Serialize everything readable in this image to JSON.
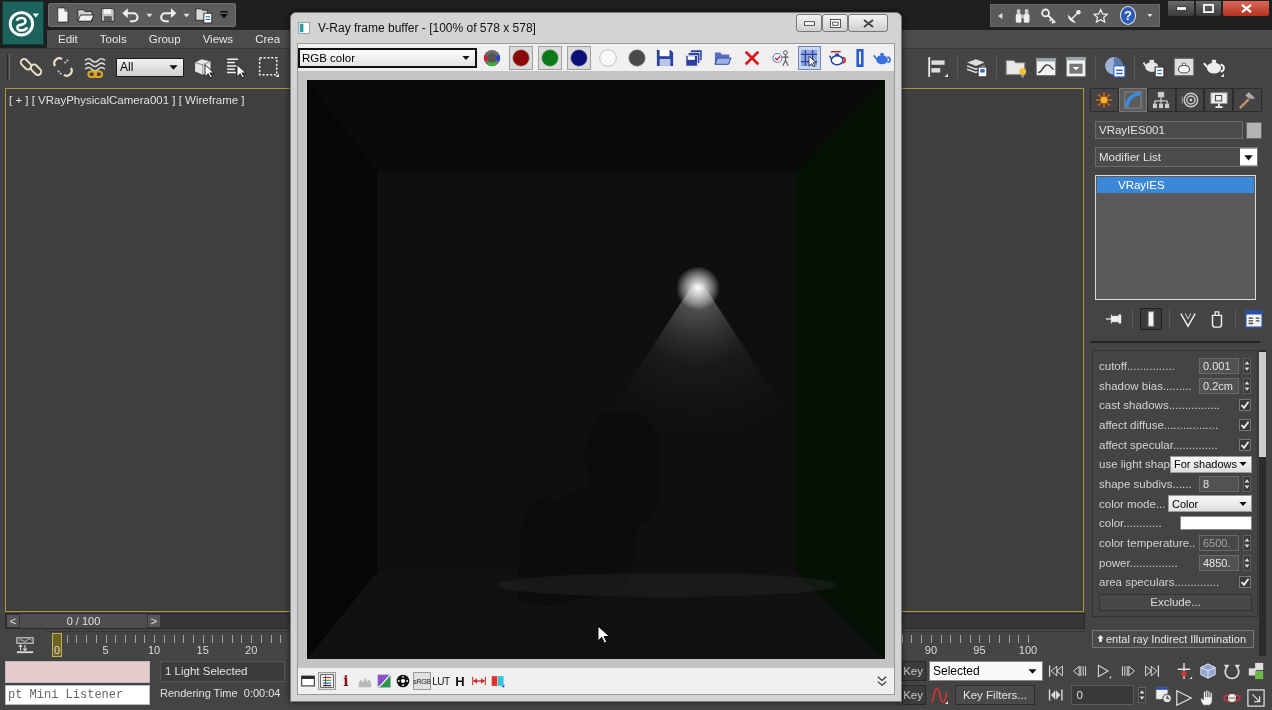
{
  "app": {
    "menu": [
      {
        "label": "Edit"
      },
      {
        "label": "Tools"
      },
      {
        "label": "Group"
      },
      {
        "label": "Views"
      },
      {
        "label": "Crea"
      }
    ],
    "help": "?",
    "selection_filter": "All"
  },
  "viewport": {
    "label": "[ + ] [ VRayPhysicalCamera001 ] [ Wireframe ]"
  },
  "command_panel": {
    "tabs": [
      {
        "kind": "create",
        "selected": false
      },
      {
        "kind": "modify",
        "selected": true
      },
      {
        "kind": "hierarchy",
        "selected": false
      },
      {
        "kind": "motion",
        "selected": false
      },
      {
        "kind": "display",
        "selected": false
      },
      {
        "kind": "utilities",
        "selected": false
      }
    ],
    "object_name": "VRayIES001",
    "modifier_list": "Modifier List",
    "stack": [
      {
        "label": "VRayIES",
        "selected": true
      }
    ],
    "stack_tools": [
      {
        "kind": "pin",
        "on": false
      },
      {
        "kind": "end-result",
        "on": true
      },
      {
        "kind": "unique",
        "on": false
      },
      {
        "kind": "remove",
        "on": false
      },
      {
        "kind": "configure",
        "on": false
      }
    ],
    "params": [
      {
        "kind": "spinner",
        "label": "cutoff...............",
        "value": "0.001",
        "disabled": false
      },
      {
        "kind": "spinner",
        "label": "shadow bias.........",
        "value": "0.2cm",
        "disabled": false
      },
      {
        "kind": "checkbox",
        "label": "cast shadows................",
        "checked": true
      },
      {
        "kind": "checkbox",
        "label": "affect diffuse.................",
        "checked": true
      },
      {
        "kind": "checkbox",
        "label": "affect specular..............",
        "checked": true
      },
      {
        "kind": "dropdown",
        "label": "use light shap",
        "value": "For shadows"
      },
      {
        "kind": "spinner",
        "label": "shape subdivs......",
        "value": "8",
        "disabled": false
      },
      {
        "kind": "dropdown",
        "label": "color mode...",
        "value": "Color"
      },
      {
        "kind": "color",
        "label": "color............",
        "color": "#ffffff"
      },
      {
        "kind": "spinner",
        "label": "color temperature..",
        "value": "6500.",
        "disabled": true
      },
      {
        "kind": "spinner",
        "label": "power...............",
        "value": "4850.",
        "disabled": false
      },
      {
        "kind": "checkbox",
        "label": "area speculars..............",
        "checked": true
      },
      {
        "kind": "button",
        "label": "Exclude..."
      }
    ],
    "rollout": "ental ray Indirect Illumination"
  },
  "time_slider": {
    "prev": "<",
    "position": "0 / 100",
    "next": ">",
    "level": 0
  },
  "track_bar": {
    "ticks": [
      "0",
      "5",
      "10",
      "15",
      "20",
      "90",
      "95",
      "100"
    ]
  },
  "status": {
    "listener": "pt Mini Listener",
    "selection": "1 Light Selected",
    "render_time": "Rendering Time  0:00:04",
    "key_buttons": [
      "Key",
      "Key"
    ],
    "key_mode": "Selected",
    "key_filters": "Key Filters...",
    "frame": "0"
  },
  "frame_buffer": {
    "title": "V-Ray frame buffer - [100% of 578 x 578]",
    "channel": "RGB color",
    "channels": [
      {
        "kind": "rgb",
        "on": false
      },
      {
        "kind": "dot",
        "color": "#8a0a0a",
        "on": true
      },
      {
        "kind": "dot",
        "color": "#0b7a18",
        "on": true
      },
      {
        "kind": "dot",
        "color": "#0a1078",
        "on": true
      },
      {
        "kind": "dot",
        "color": "#f8f8f8",
        "on": false
      },
      {
        "kind": "dot",
        "color": "#4a4a4a",
        "on": false
      }
    ],
    "tools": [
      {
        "kind": "save",
        "on": false
      },
      {
        "kind": "duplicate",
        "on": false
      },
      {
        "kind": "open",
        "on": false
      },
      {
        "kind": "clear",
        "on": false
      },
      {
        "kind": "track",
        "on": false
      },
      {
        "kind": "region",
        "on": true
      },
      {
        "kind": "render",
        "on": false
      },
      {
        "kind": "bracket",
        "on": false
      },
      {
        "kind": "teapot",
        "on": false
      }
    ],
    "bottom_tools": [
      {
        "kind": "window",
        "on": false
      },
      {
        "kind": "corrections",
        "on": true
      },
      {
        "kind": "info",
        "label": "i",
        "on": false
      },
      {
        "kind": "levels",
        "on": false
      },
      {
        "kind": "curve",
        "on": false
      },
      {
        "kind": "exposure",
        "on": false
      },
      {
        "kind": "srgb",
        "label": "sRGB",
        "on": true
      },
      {
        "kind": "lut",
        "label": "LUT",
        "on": false
      },
      {
        "kind": "h",
        "label": "H",
        "on": false
      },
      {
        "kind": "arrows",
        "on": false
      },
      {
        "kind": "compare",
        "on": false
      }
    ]
  }
}
